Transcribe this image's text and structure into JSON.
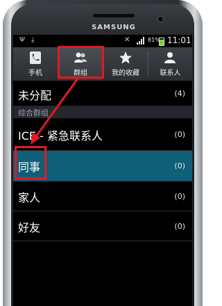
{
  "device": {
    "brand": "SAMSUNG"
  },
  "status_bar": {
    "battery_percent": "81%",
    "time": "11:01",
    "battery_level": 0.81
  },
  "tabs": [
    {
      "label": "手机",
      "icon": "phone-icon",
      "selected": false
    },
    {
      "label": "群组",
      "icon": "groups-icon",
      "selected": true
    },
    {
      "label": "我的收藏",
      "icon": "star-icon",
      "selected": false
    },
    {
      "label": "联系人",
      "icon": "person-icon",
      "selected": false
    }
  ],
  "groups": {
    "unassigned": {
      "label": "未分配",
      "count": "(4)"
    },
    "section_header": "综合群组",
    "items": [
      {
        "label": "ICE - 紧急联系人",
        "count": "(0)",
        "highlighted": false
      },
      {
        "label": "同事",
        "count": "(0)",
        "highlighted": true
      },
      {
        "label": "家人",
        "count": "(0)",
        "highlighted": false
      },
      {
        "label": "好友",
        "count": "(0)",
        "highlighted": false
      }
    ]
  },
  "colors": {
    "highlight": "#0f5f78",
    "annotation": "#e11a22"
  }
}
